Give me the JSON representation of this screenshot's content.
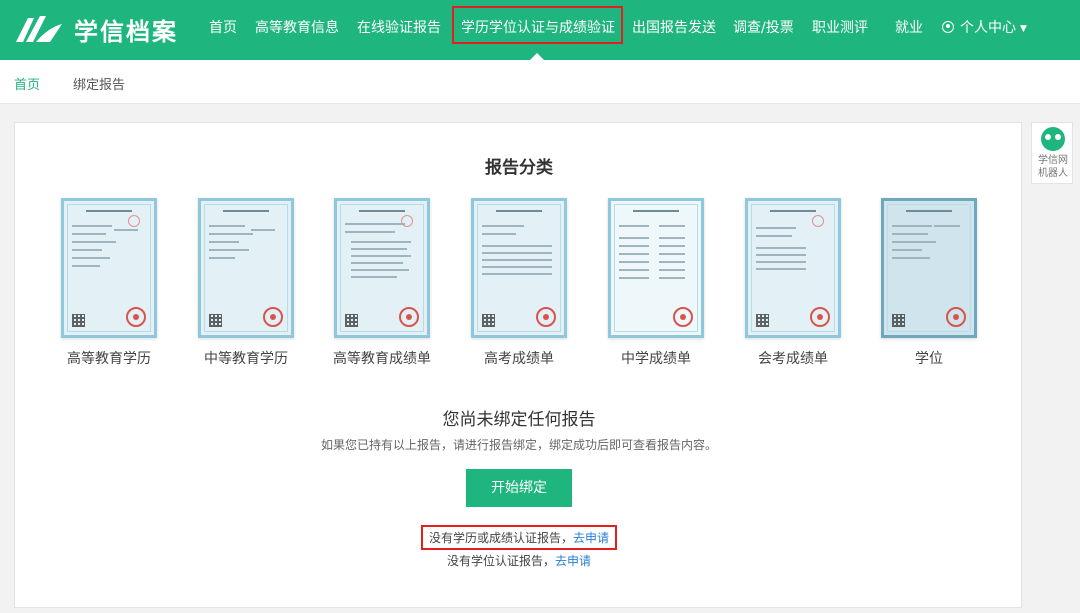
{
  "app": {
    "title": "学信档案",
    "brand_color": "#1fb57f",
    "highlight_color": "#e02020",
    "link_color": "#2a7fd4"
  },
  "nav": {
    "items": [
      {
        "label": "首页"
      },
      {
        "label": "高等教育信息"
      },
      {
        "label": "在线验证报告"
      },
      {
        "label": "学历学位认证与成绩验证",
        "active": true
      },
      {
        "label": "出国报告发送"
      },
      {
        "label": "调查/投票"
      },
      {
        "label": "职业测评"
      },
      {
        "label": "就业"
      }
    ],
    "user_center": "个人中心",
    "user_icon": "user-circle-icon",
    "dropdown_icon": "caret-down-icon"
  },
  "breadcrumb": {
    "home": "首页",
    "current": "绑定报告"
  },
  "reports": {
    "title": "报告分类",
    "items": [
      {
        "label": "高等教育学历"
      },
      {
        "label": "中等教育学历"
      },
      {
        "label": "高等教育成绩单"
      },
      {
        "label": "高考成绩单"
      },
      {
        "label": "中学成绩单"
      },
      {
        "label": "会考成绩单"
      },
      {
        "label": "学位"
      }
    ]
  },
  "empty_state": {
    "title": "您尚未绑定任何报告",
    "description": "如果您已持有以上报告，请进行报告绑定，绑定成功后即可查看报告内容。",
    "bind_button": "开始绑定",
    "apply_1_text": "没有学历或成绩认证报告，",
    "apply_1_link": "去申请",
    "apply_2_text": "没有学位认证报告，",
    "apply_2_link": "去申请"
  },
  "robot": {
    "label_line1": "学信网",
    "label_line2": "机器人",
    "icon": "robot-icon"
  }
}
